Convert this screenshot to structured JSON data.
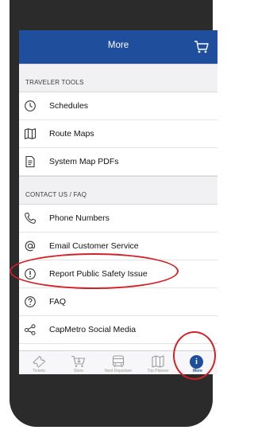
{
  "header": {
    "title": "More"
  },
  "sections": [
    {
      "label": "TRAVELER TOOLS",
      "items": [
        {
          "label": "Schedules",
          "icon": "clock-icon"
        },
        {
          "label": "Route Maps",
          "icon": "map-icon"
        },
        {
          "label": "System Map PDFs",
          "icon": "document-icon"
        }
      ]
    },
    {
      "label": "CONTACT US / FAQ",
      "items": [
        {
          "label": "Phone Numbers",
          "icon": "phone-icon"
        },
        {
          "label": "Email Customer Service",
          "icon": "at-sign-icon"
        },
        {
          "label": "Report Public Safety Issue",
          "icon": "exclamation-circle-icon"
        },
        {
          "label": "FAQ",
          "icon": "question-circle-icon"
        },
        {
          "label": "CapMetro Social Media",
          "icon": "share-icon"
        }
      ]
    }
  ],
  "tabs": [
    {
      "label": "Tickets",
      "icon": "ticket-icon"
    },
    {
      "label": "Store",
      "icon": "cart-icon"
    },
    {
      "label": "Next Departure",
      "icon": "bus-icon"
    },
    {
      "label": "Trip Planner",
      "icon": "map-icon"
    },
    {
      "label": "More",
      "icon": "info-icon",
      "active": true
    }
  ],
  "more_glyph": "i",
  "colors": {
    "header": "#1f4e9c",
    "highlight": "#d42128",
    "active_tab": "#1f4e9c"
  }
}
